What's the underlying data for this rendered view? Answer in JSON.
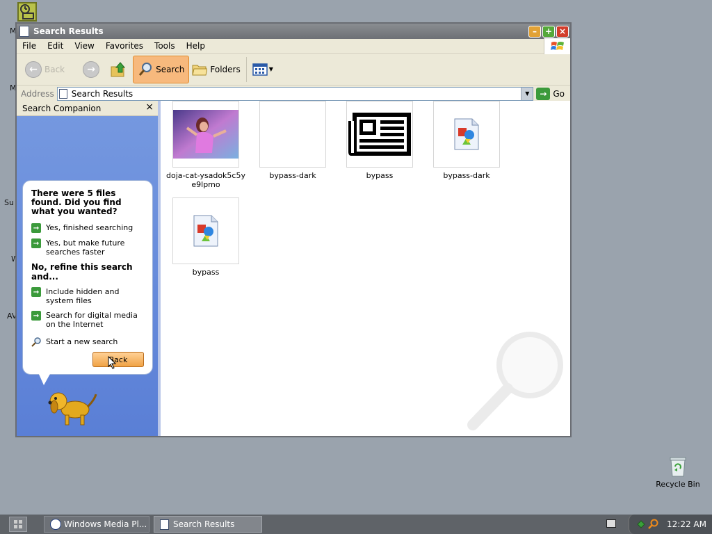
{
  "window": {
    "title": "Search Results",
    "menus": [
      "File",
      "Edit",
      "View",
      "Favorites",
      "Tools",
      "Help"
    ]
  },
  "toolbar": {
    "back_label": "Back",
    "search_label": "Search",
    "folders_label": "Folders"
  },
  "address": {
    "label": "Address",
    "value": "Search Results",
    "go_label": "Go"
  },
  "companion": {
    "header": "Search Companion",
    "question": "There were 5 files found. Did you find what you wanted?",
    "yes_finished": "Yes, finished searching",
    "yes_faster": "Yes, but make future searches faster",
    "refine_heading": "No, refine this search and...",
    "hidden_files": "Include hidden and system files",
    "digital_media": "Search for digital media on the Internet",
    "new_search": "Start a new search",
    "back_button": "Back"
  },
  "results": [
    {
      "name": "doja-cat-ysadok5c5ye9lpmo",
      "type": "photo"
    },
    {
      "name": "bypass-dark",
      "type": "blank"
    },
    {
      "name": "bypass",
      "type": "newspaper"
    },
    {
      "name": "bypass-dark",
      "type": "image-file"
    },
    {
      "name": "bypass",
      "type": "image-file"
    }
  ],
  "desktop": {
    "recycle_bin": "Recycle Bin",
    "fragments": [
      "M",
      "M",
      "Su",
      "W",
      "AV"
    ]
  },
  "taskbar": {
    "tasks": [
      "Windows Media Pl...",
      "Search Results"
    ],
    "clock": "12:22 AM"
  }
}
